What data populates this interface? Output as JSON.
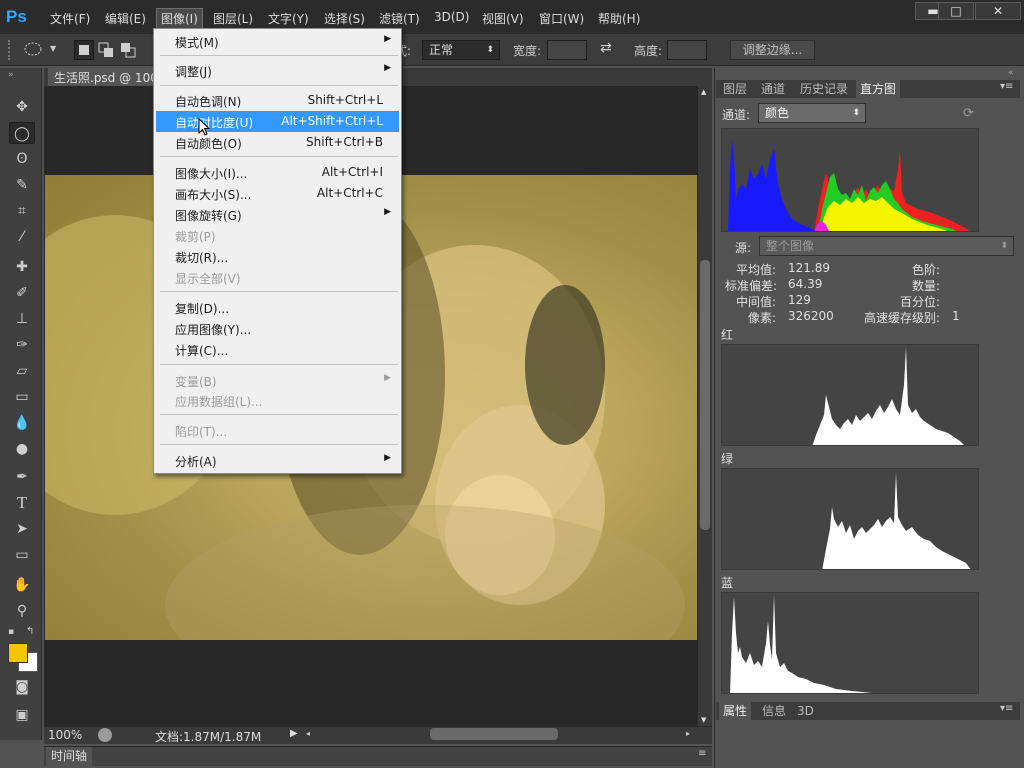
{
  "app": {
    "logo": "Ps"
  },
  "menubar": {
    "items": [
      "文件(F)",
      "编辑(E)",
      "图像(I)",
      "图层(L)",
      "文字(Y)",
      "选择(S)",
      "滤镜(T)",
      "3D(D)",
      "视图(V)",
      "窗口(W)",
      "帮助(H)"
    ],
    "active_index": 2
  },
  "window_controls": {
    "minimize": "▬",
    "restore": "□",
    "close": "✕"
  },
  "options": {
    "style_label": "式:",
    "style_value": "正常",
    "width_label": "宽度:",
    "height_label": "高度:",
    "refine_edge": "调整边缘..."
  },
  "document": {
    "tab_title": "生活照.psd @ 100",
    "zoom": "100%",
    "doc_info": "文档:1.87M/1.87M"
  },
  "timeline": {
    "tab": "时间轴"
  },
  "image_menu": {
    "items": [
      {
        "label": "模式(M)",
        "shortcut": "",
        "submenu": true,
        "disabled": false
      },
      {
        "label": "调整(J)",
        "shortcut": "",
        "submenu": true,
        "disabled": false
      },
      {
        "label": "自动色调(N)",
        "shortcut": "Shift+Ctrl+L",
        "submenu": false,
        "disabled": false
      },
      {
        "label": "自动对比度(U)",
        "shortcut": "Alt+Shift+Ctrl+L",
        "submenu": false,
        "disabled": false,
        "highlighted": true
      },
      {
        "label": "自动颜色(O)",
        "shortcut": "Shift+Ctrl+B",
        "submenu": false,
        "disabled": false
      },
      {
        "label": "图像大小(I)...",
        "shortcut": "Alt+Ctrl+I",
        "submenu": false,
        "disabled": false
      },
      {
        "label": "画布大小(S)...",
        "shortcut": "Alt+Ctrl+C",
        "submenu": false,
        "disabled": false
      },
      {
        "label": "图像旋转(G)",
        "shortcut": "",
        "submenu": true,
        "disabled": false
      },
      {
        "label": "裁剪(P)",
        "shortcut": "",
        "submenu": false,
        "disabled": true
      },
      {
        "label": "裁切(R)...",
        "shortcut": "",
        "submenu": false,
        "disabled": false
      },
      {
        "label": "显示全部(V)",
        "shortcut": "",
        "submenu": false,
        "disabled": true
      },
      {
        "label": "复制(D)...",
        "shortcut": "",
        "submenu": false,
        "disabled": false
      },
      {
        "label": "应用图像(Y)...",
        "shortcut": "",
        "submenu": false,
        "disabled": false
      },
      {
        "label": "计算(C)...",
        "shortcut": "",
        "submenu": false,
        "disabled": false
      },
      {
        "label": "变量(B)",
        "shortcut": "",
        "submenu": true,
        "disabled": true
      },
      {
        "label": "应用数据组(L)...",
        "shortcut": "",
        "submenu": false,
        "disabled": true
      },
      {
        "label": "陷印(T)...",
        "shortcut": "",
        "submenu": false,
        "disabled": true
      },
      {
        "label": "分析(A)",
        "shortcut": "",
        "submenu": true,
        "disabled": false
      }
    ]
  },
  "panel": {
    "tabs": [
      "图层",
      "通道",
      "历史记录",
      "直方图"
    ],
    "active_tab": 3,
    "channel_label": "通道:",
    "channel_value": "颜色",
    "source_label": "源:",
    "source_value": "整个图像",
    "stats": {
      "mean_label": "平均值:",
      "mean": "121.89",
      "std_label": "标准偏差:",
      "std": "64.39",
      "median_label": "中间值:",
      "median": "129",
      "pixels_label": "像素:",
      "pixels": "326200",
      "level_label": "色阶:",
      "level": "",
      "count_label": "数量:",
      "count": "",
      "percentile_label": "百分位:",
      "percentile": "",
      "cache_label": "高速缓存级别:",
      "cache": "1"
    },
    "red_label": "红",
    "green_label": "绿",
    "blue_label": "蓝",
    "bottom_tabs": [
      "属性",
      "信息",
      "3D"
    ]
  },
  "colors": {
    "foreground": "#f5c400",
    "background": "#ffffff",
    "menu_highlight": "#3399ff",
    "ps_blue": "#31a8ff"
  }
}
